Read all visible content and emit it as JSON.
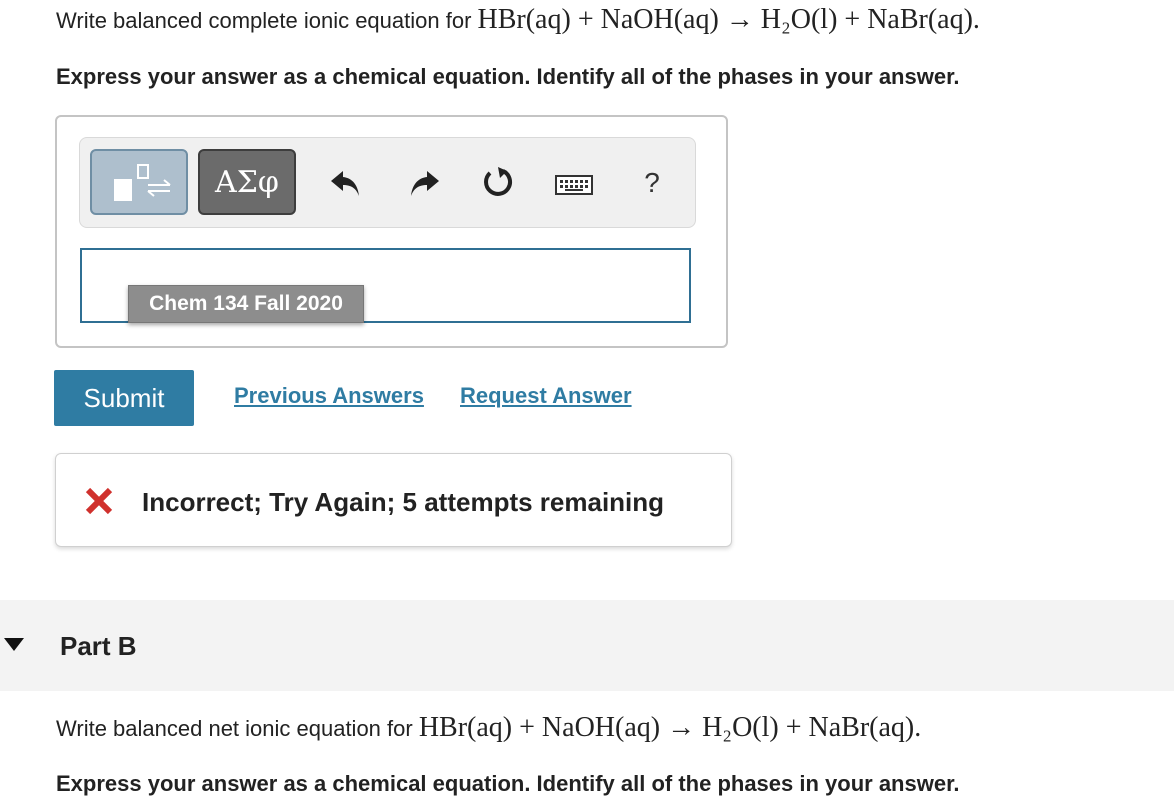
{
  "part_a": {
    "prompt_text": "Write balanced complete ionic equation for ",
    "equation": "HBr(aq) + NaOH(aq) → H₂O(l) + NaBr(aq).",
    "instruction": "Express your answer as a chemical equation. Identify all of the phases in your answer.",
    "toolbar": {
      "template_icon": "templates-icon",
      "greek_label": "ΑΣφ",
      "undo_icon": "undo-icon",
      "redo_icon": "redo-icon",
      "reset_icon": "reset-icon",
      "keyboard_icon": "keyboard-icon",
      "help_label": "?"
    },
    "answer_value": "",
    "tooltip": "Chem 134 Fall 2020",
    "submit_label": "Submit",
    "previous_answers_label": "Previous Answers",
    "request_answer_label": "Request Answer",
    "feedback": {
      "icon": "x-mark-icon",
      "text": "Incorrect; Try Again; 5 attempts remaining",
      "color": "#d0312d"
    }
  },
  "part_b": {
    "title": "Part B",
    "expand_icon": "caret-down-icon",
    "prompt_text": "Write balanced net ionic equation for ",
    "equation": "HBr(aq) + NaOH(aq) → H₂O(l) + NaBr(aq).",
    "instruction": "Express your answer as a chemical equation. Identify all of the phases in your answer."
  },
  "colors": {
    "accent": "#2f7ca3",
    "error": "#d0312d",
    "greek_button": "#6b6b6b",
    "template_button": "#aebfcd"
  }
}
